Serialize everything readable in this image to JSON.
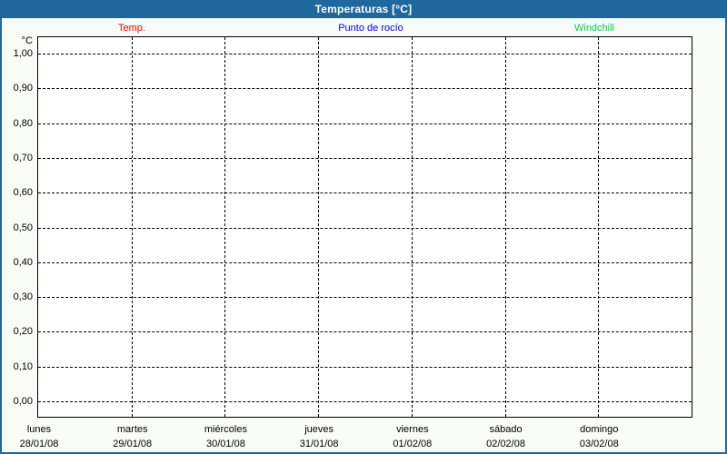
{
  "window": {
    "title": "Temperaturas [°C]"
  },
  "colors": {
    "titlebar_bg": "#1e689e",
    "frame_border": "#1e689e",
    "page_bg": "#f7fcf7",
    "plot_bg": "#ffffff",
    "grid": "#000000",
    "temp_red": "#ff0000",
    "dewpoint_blue": "#0000ff",
    "windchill_green": "#00ce4a"
  },
  "legend": [
    {
      "label": "Temp.",
      "color": "#ff0000"
    },
    {
      "label": "Punto de rocío",
      "color": "#0000ff"
    },
    {
      "label": "Windchill",
      "color": "#00ce4a"
    }
  ],
  "chart_data": {
    "type": "line",
    "title": "Temperaturas [°C]",
    "ylabel": "°C",
    "ylim": [
      0.0,
      1.0
    ],
    "grid": "dashed",
    "legend_position": "top",
    "y_ticks": [
      {
        "label": "1,00",
        "value": 1.0
      },
      {
        "label": "0,90",
        "value": 0.9
      },
      {
        "label": "0,80",
        "value": 0.8
      },
      {
        "label": "0,70",
        "value": 0.7
      },
      {
        "label": "0,60",
        "value": 0.6
      },
      {
        "label": "0,50",
        "value": 0.5
      },
      {
        "label": "0,40",
        "value": 0.4
      },
      {
        "label": "0,30",
        "value": 0.3
      },
      {
        "label": "0,20",
        "value": 0.2
      },
      {
        "label": "0,10",
        "value": 0.1
      },
      {
        "label": "0,00",
        "value": 0.0
      }
    ],
    "x_days": [
      {
        "name": "lunes",
        "date": "28/01/08"
      },
      {
        "name": "martes",
        "date": "29/01/08"
      },
      {
        "name": "miércoles",
        "date": "30/01/08"
      },
      {
        "name": "jueves",
        "date": "31/01/08"
      },
      {
        "name": "viernes",
        "date": "01/02/08"
      },
      {
        "name": "sábado",
        "date": "02/02/08"
      },
      {
        "name": "domingo",
        "date": "03/02/08"
      }
    ],
    "series": [
      {
        "name": "Temp.",
        "color": "#ff0000",
        "values": []
      },
      {
        "name": "Punto de rocío",
        "color": "#0000ff",
        "values": []
      },
      {
        "name": "Windchill",
        "color": "#00ce4a",
        "values": []
      }
    ]
  }
}
